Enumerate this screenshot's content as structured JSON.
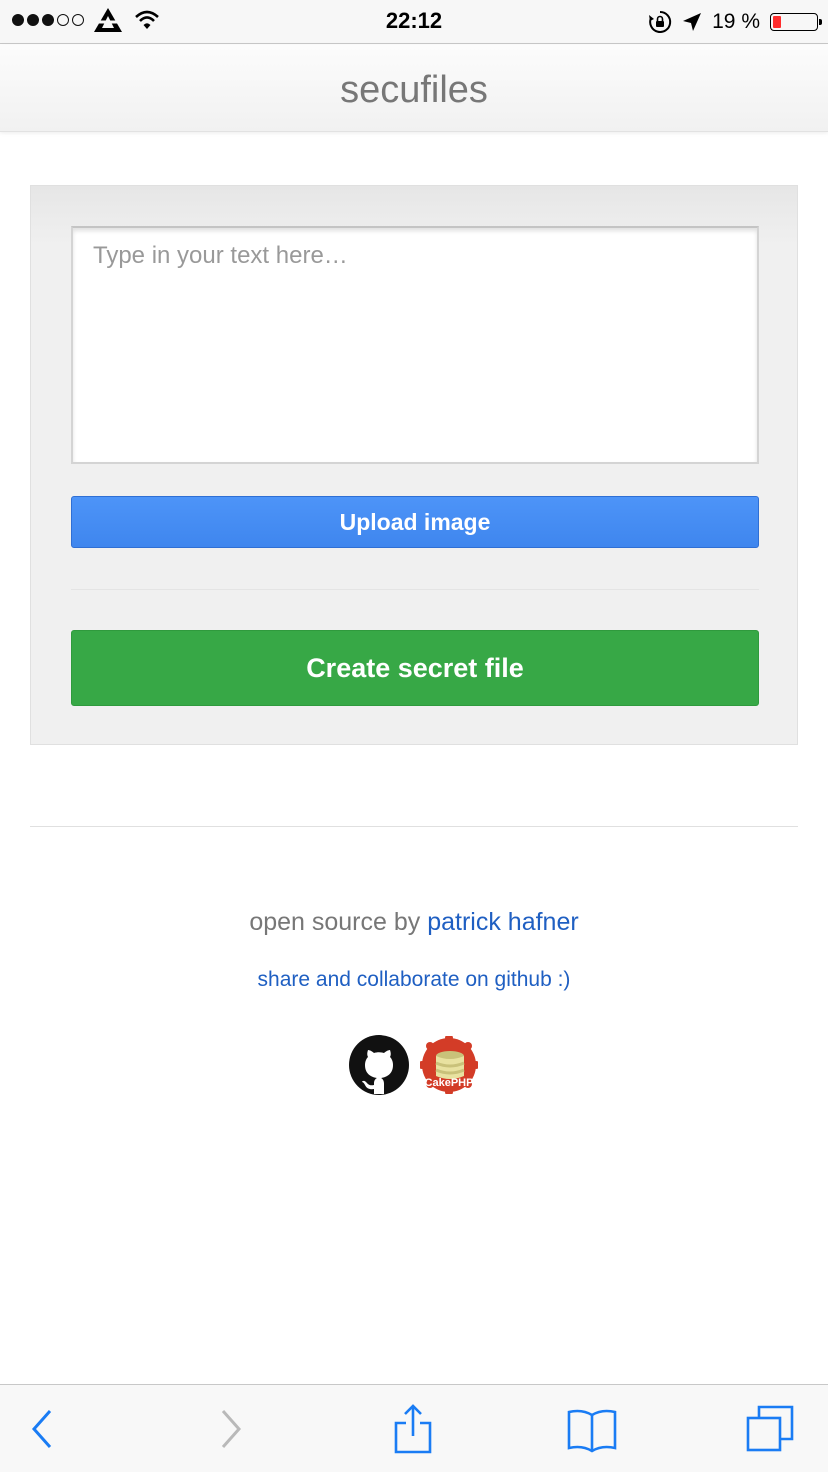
{
  "status_bar": {
    "time": "22:12",
    "battery_text": "19 %",
    "battery_level": 0.19,
    "signal_bars_filled": 3,
    "signal_bars_total": 5,
    "icons": [
      "signal-dots-icon",
      "carrier-logo-icon",
      "wifi-icon",
      "orientation-lock-icon",
      "location-arrow-icon",
      "battery-icon"
    ]
  },
  "header": {
    "title": "secufiles"
  },
  "form": {
    "text_placeholder": "Type in your text here…",
    "text_value": "",
    "upload_label": "Upload image",
    "create_label": "Create secret file"
  },
  "footer": {
    "credit_prefix": "open source by",
    "author_name": "patrick hafner",
    "github_text": "share and collaborate on github :)",
    "logos": [
      "github-logo",
      "cakephp-logo"
    ],
    "cake_logo_text": "CakePHP"
  },
  "toolbar": {
    "icons": [
      "back-icon",
      "forward-icon",
      "share-icon",
      "bookmarks-icon",
      "tabs-icon"
    ]
  },
  "colors": {
    "upload_button": "#4a8ff5",
    "create_button": "#37a846",
    "link": "#1f5fc2",
    "ios_blue": "#1a7cf4"
  }
}
